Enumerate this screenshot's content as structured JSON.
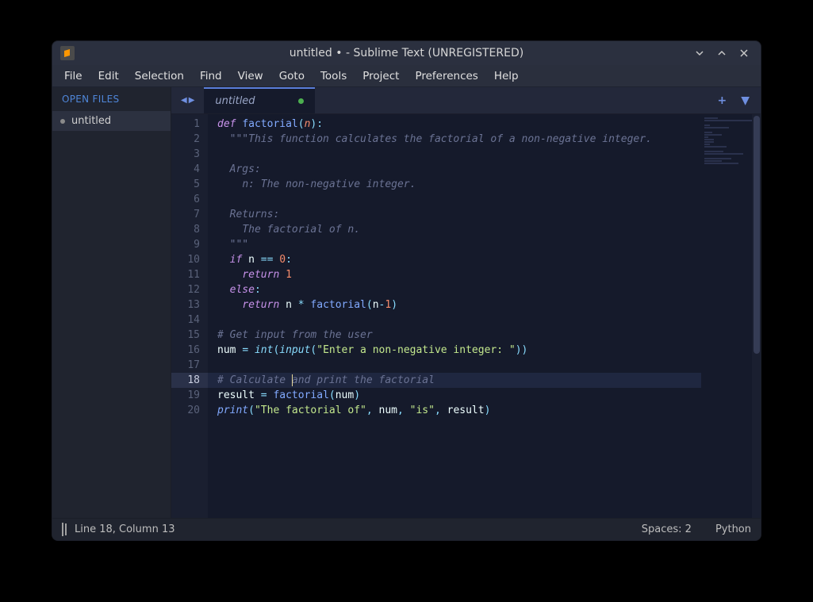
{
  "title": "untitled • - Sublime Text (UNREGISTERED)",
  "menu": [
    "File",
    "Edit",
    "Selection",
    "Find",
    "View",
    "Goto",
    "Tools",
    "Project",
    "Preferences",
    "Help"
  ],
  "sidebar": {
    "header": "OPEN FILES",
    "items": [
      {
        "label": "untitled",
        "modified": true
      }
    ]
  },
  "tabs": [
    {
      "label": "untitled",
      "modified": true
    }
  ],
  "status": {
    "pos": "Line 18, Column 13",
    "spaces": "Spaces: 2",
    "syntax": "Python"
  },
  "cursor": {
    "line": 18,
    "col": 13
  },
  "code": {
    "lines": [
      {
        "n": 1,
        "t": [
          [
            "kw",
            "def "
          ],
          [
            "fn",
            "factorial"
          ],
          [
            "pun",
            "("
          ],
          [
            "param",
            "n"
          ],
          [
            "pun",
            ")"
          ],
          [
            "pun",
            ":"
          ]
        ]
      },
      {
        "n": 2,
        "t": [
          [
            "",
            "  "
          ],
          [
            "docq",
            "\"\"\""
          ],
          [
            "doc",
            "This function calculates the factorial of a non-negative integer."
          ]
        ]
      },
      {
        "n": 3,
        "t": []
      },
      {
        "n": 4,
        "t": [
          [
            "",
            "  "
          ],
          [
            "doc",
            "Args:"
          ]
        ]
      },
      {
        "n": 5,
        "t": [
          [
            "",
            "    "
          ],
          [
            "doc",
            "n: The non-negative integer."
          ]
        ]
      },
      {
        "n": 6,
        "t": []
      },
      {
        "n": 7,
        "t": [
          [
            "",
            "  "
          ],
          [
            "doc",
            "Returns:"
          ]
        ]
      },
      {
        "n": 8,
        "t": [
          [
            "",
            "    "
          ],
          [
            "doc",
            "The factorial of n."
          ]
        ]
      },
      {
        "n": 9,
        "t": [
          [
            "",
            "  "
          ],
          [
            "docq",
            "\"\"\""
          ]
        ]
      },
      {
        "n": 10,
        "t": [
          [
            "",
            "  "
          ],
          [
            "kw",
            "if"
          ],
          [
            "",
            " "
          ],
          [
            "var",
            "n"
          ],
          [
            "",
            " "
          ],
          [
            "pun",
            "=="
          ],
          [
            "",
            " "
          ],
          [
            "num",
            "0"
          ],
          [
            "pun",
            ":"
          ]
        ]
      },
      {
        "n": 11,
        "t": [
          [
            "",
            "    "
          ],
          [
            "kw",
            "return"
          ],
          [
            "",
            " "
          ],
          [
            "num",
            "1"
          ]
        ]
      },
      {
        "n": 12,
        "t": [
          [
            "",
            "  "
          ],
          [
            "kw",
            "else"
          ],
          [
            "pun",
            ":"
          ]
        ]
      },
      {
        "n": 13,
        "t": [
          [
            "",
            "    "
          ],
          [
            "kw",
            "return"
          ],
          [
            "",
            " "
          ],
          [
            "var",
            "n"
          ],
          [
            "",
            " "
          ],
          [
            "pun",
            "*"
          ],
          [
            "",
            " "
          ],
          [
            "fn",
            "factorial"
          ],
          [
            "pun",
            "("
          ],
          [
            "var",
            "n"
          ],
          [
            "pun",
            "-"
          ],
          [
            "num",
            "1"
          ],
          [
            "pun",
            ")"
          ]
        ]
      },
      {
        "n": 14,
        "t": []
      },
      {
        "n": 15,
        "t": [
          [
            "cmt",
            "# Get input from the user"
          ]
        ]
      },
      {
        "n": 16,
        "t": [
          [
            "var",
            "num"
          ],
          [
            "",
            " "
          ],
          [
            "pun",
            "="
          ],
          [
            "",
            " "
          ],
          [
            "sup",
            "int"
          ],
          [
            "pun",
            "("
          ],
          [
            "sup",
            "input"
          ],
          [
            "pun",
            "("
          ],
          [
            "str",
            "\"Enter a non-negative integer: \""
          ],
          [
            "pun",
            "))"
          ]
        ]
      },
      {
        "n": 17,
        "t": []
      },
      {
        "n": 18,
        "t": [
          [
            "cmt",
            "# Calculate and print the factorial"
          ]
        ],
        "active": true
      },
      {
        "n": 19,
        "t": [
          [
            "var",
            "result"
          ],
          [
            "",
            " "
          ],
          [
            "pun",
            "="
          ],
          [
            "",
            " "
          ],
          [
            "fn",
            "factorial"
          ],
          [
            "pun",
            "("
          ],
          [
            "var",
            "num"
          ],
          [
            "pun",
            ")"
          ]
        ]
      },
      {
        "n": 20,
        "t": [
          [
            "fnit",
            "print"
          ],
          [
            "pun",
            "("
          ],
          [
            "str",
            "\"The factorial of\""
          ],
          [
            "pun",
            ","
          ],
          [
            "",
            " "
          ],
          [
            "var",
            "num"
          ],
          [
            "pun",
            ","
          ],
          [
            "",
            " "
          ],
          [
            "str",
            "\"is\""
          ],
          [
            "pun",
            ","
          ],
          [
            "",
            " "
          ],
          [
            "var",
            "result"
          ],
          [
            "pun",
            ")"
          ]
        ]
      }
    ]
  }
}
